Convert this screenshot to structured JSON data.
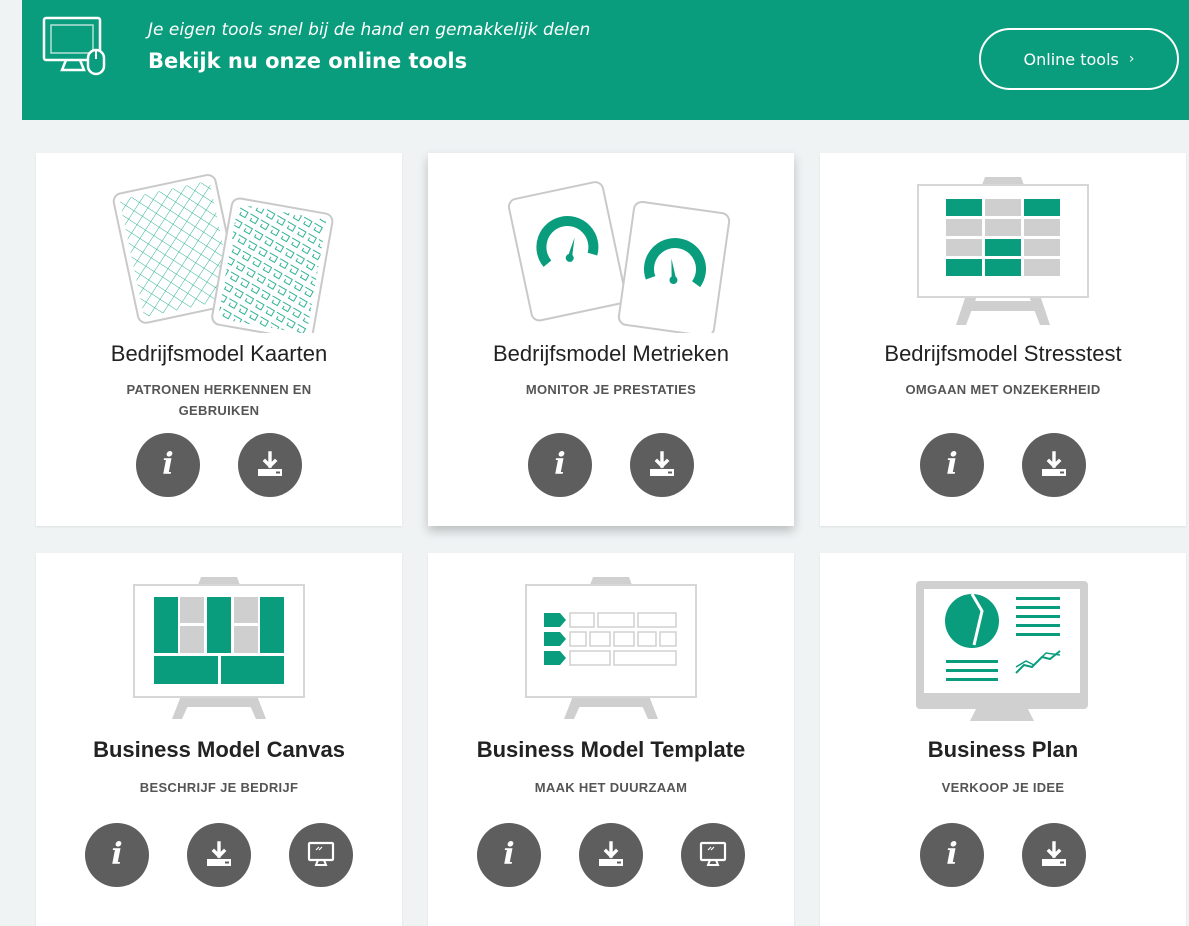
{
  "banner": {
    "subtitle": "Je eigen tools snel bij de hand en gemakkelijk delen",
    "title": "Bekijk nu onze online tools",
    "button_label": "Online tools",
    "button_chevron": "›",
    "icon": "computer-mouse-icon"
  },
  "colors": {
    "brand_green": "#0a9d7d",
    "page_bg": "#eff3f4",
    "button_grey": "#5e5e5e",
    "art_grey": "#cfcfcf"
  },
  "cards": [
    {
      "title": "Bedrijfsmodel Kaarten",
      "subtitle": "PATRONEN HERKENNEN EN GEBRUIKEN",
      "actions": [
        "info-icon",
        "download-icon"
      ]
    },
    {
      "title": "Bedrijfsmodel Metrieken",
      "subtitle": "MONITOR JE PRESTATIES",
      "actions": [
        "info-icon",
        "download-icon"
      ]
    },
    {
      "title": "Bedrijfsmodel Stresstest",
      "subtitle": "OMGAAN MET ONZEKERHEID",
      "actions": [
        "info-icon",
        "download-icon"
      ]
    },
    {
      "title": "Business Model Canvas",
      "subtitle": "BESCHRIJF JE BEDRIJF",
      "actions": [
        "info-icon",
        "download-icon",
        "online-tool-icon"
      ]
    },
    {
      "title": "Business Model Template",
      "subtitle": "MAAK HET DUURZAAM",
      "actions": [
        "info-icon",
        "download-icon",
        "online-tool-icon"
      ]
    },
    {
      "title": "Business Plan",
      "subtitle": "VERKOOP JE IDEE",
      "actions": [
        "info-icon",
        "download-icon"
      ]
    }
  ],
  "info_glyph": "i"
}
